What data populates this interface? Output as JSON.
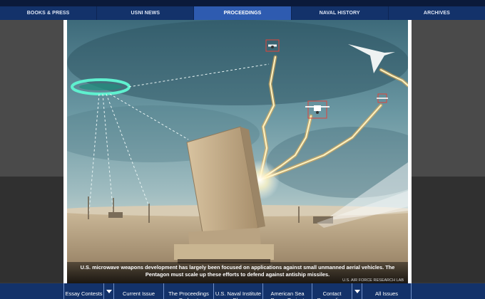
{
  "topnav": {
    "items": [
      {
        "label": "BOOKS & PRESS"
      },
      {
        "label": "USNI NEWS"
      },
      {
        "label": "PROCEEDINGS",
        "active": true
      },
      {
        "label": "NAVAL HISTORY"
      },
      {
        "label": "ARCHIVES"
      }
    ],
    "active_color": "#2e5bb0",
    "bar_color": "#13326a"
  },
  "figure": {
    "caption": "U.S. microwave weapons development has largely been focused on applications against small unmanned aerial vehicles. The Pentagon must scale up these efforts to defend against antiship missiles.",
    "credit": "U.S. AIR FORCE RESEARCH LAB"
  },
  "bottombar": {
    "items": [
      {
        "label": "Essay Contests"
      },
      {
        "label": "Current Issue"
      },
      {
        "label": "The Proceedings Podcast"
      },
      {
        "label": "U.S. Naval Institute Blog"
      },
      {
        "label": "American Sea Power Project"
      },
      {
        "label": "Contact Proceedings"
      },
      {
        "label": "All Issues"
      }
    ],
    "icons": [
      "chevron-down-icon",
      "chevron-down-icon"
    ]
  }
}
